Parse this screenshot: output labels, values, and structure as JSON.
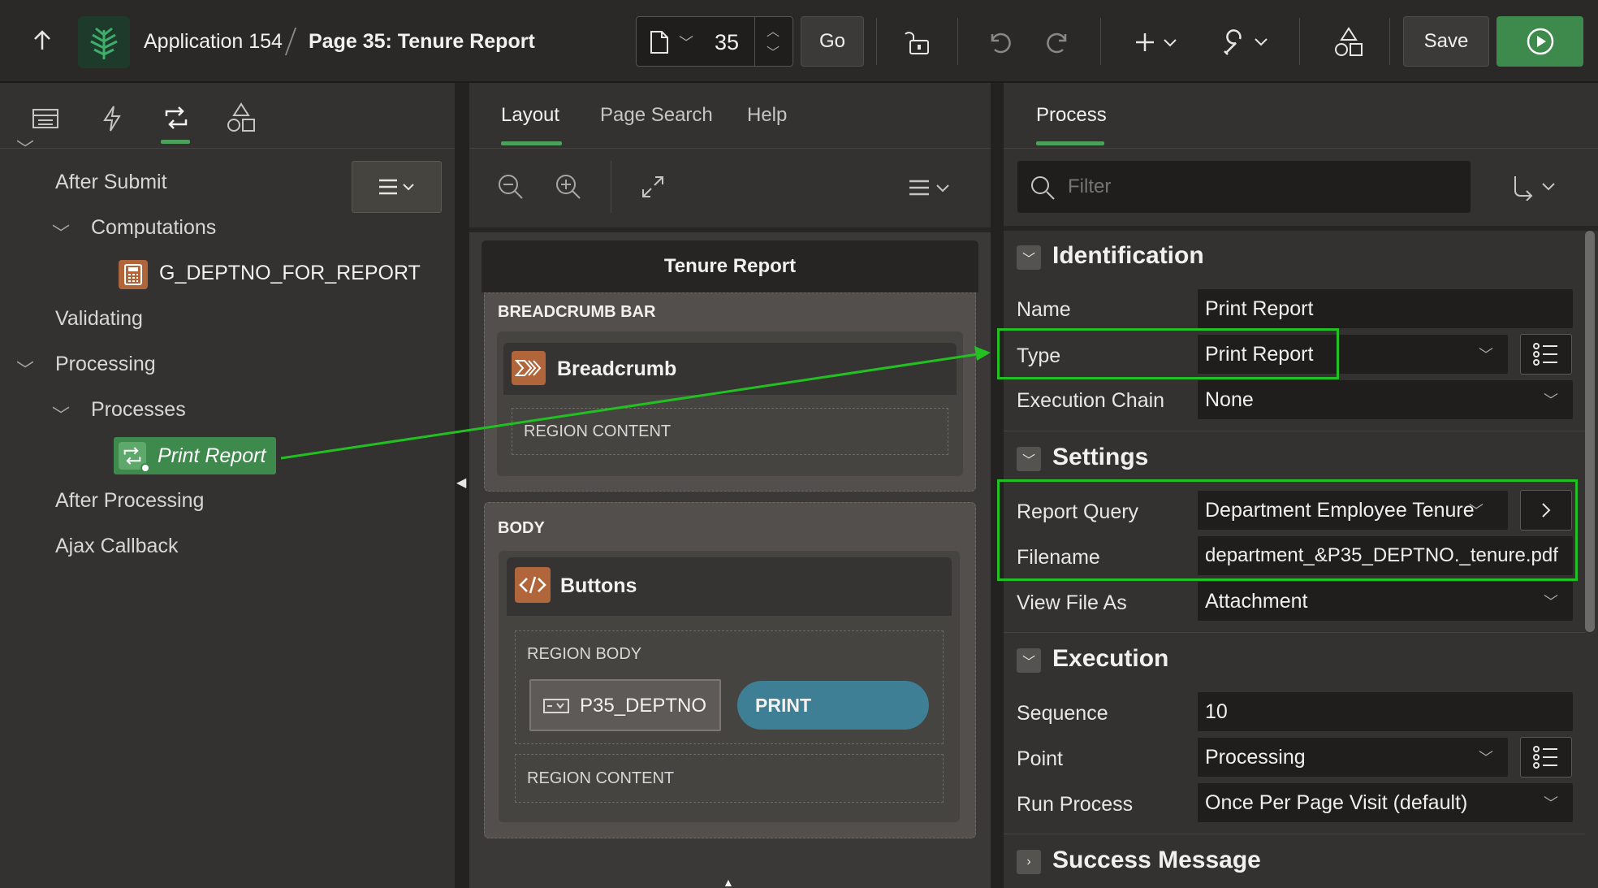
{
  "header": {
    "app_name": "Application 154",
    "page_title": "Page 35: Tenure Report",
    "page_number": "35",
    "go_label": "Go",
    "save_label": "Save"
  },
  "left_tabs": [
    "rendering-icon",
    "dynamic-actions-icon",
    "processing-icon",
    "shared-components-icon"
  ],
  "tree": {
    "after_submit": "After Submit",
    "computations": "Computations",
    "computation_item": "G_DEPTNO_FOR_REPORT",
    "validating": "Validating",
    "processing": "Processing",
    "processes": "Processes",
    "process_item": "Print Report",
    "after_processing": "After Processing",
    "ajax_callback": "Ajax Callback"
  },
  "middle": {
    "tabs": [
      "Layout",
      "Page Search",
      "Help"
    ],
    "page_region_title": "Tenure Report",
    "breadcrumb_bar": "BREADCRUMB BAR",
    "breadcrumb_region": "Breadcrumb",
    "region_content_1": "REGION CONTENT",
    "body": "BODY",
    "buttons_region": "Buttons",
    "region_body": "REGION BODY",
    "item_name": "P35_DEPTNO",
    "print_button": "PRINT",
    "region_content_2": "REGION CONTENT"
  },
  "right": {
    "tab": "Process",
    "filter_placeholder": "Filter",
    "identification": {
      "title": "Identification",
      "name_label": "Name",
      "name_value": "Print Report",
      "type_label": "Type",
      "type_value": "Print Report",
      "exec_chain_label": "Execution Chain",
      "exec_chain_value": "None"
    },
    "settings": {
      "title": "Settings",
      "report_query_label": "Report Query",
      "report_query_value": "Department Employee Tenure",
      "filename_label": "Filename",
      "filename_value": "department_&P35_DEPTNO._tenure.pdf",
      "view_as_label": "View File As",
      "view_as_value": "Attachment"
    },
    "execution": {
      "title": "Execution",
      "sequence_label": "Sequence",
      "sequence_value": "10",
      "point_label": "Point",
      "point_value": "Processing",
      "run_label": "Run Process",
      "run_value": "Once Per Page Visit (default)"
    },
    "success": {
      "title": "Success Message"
    }
  },
  "colors": {
    "accent_green": "#4d9f5c",
    "highlight": "#22c022",
    "print_button": "#3f7f95",
    "run_button": "#3e8a4c"
  }
}
